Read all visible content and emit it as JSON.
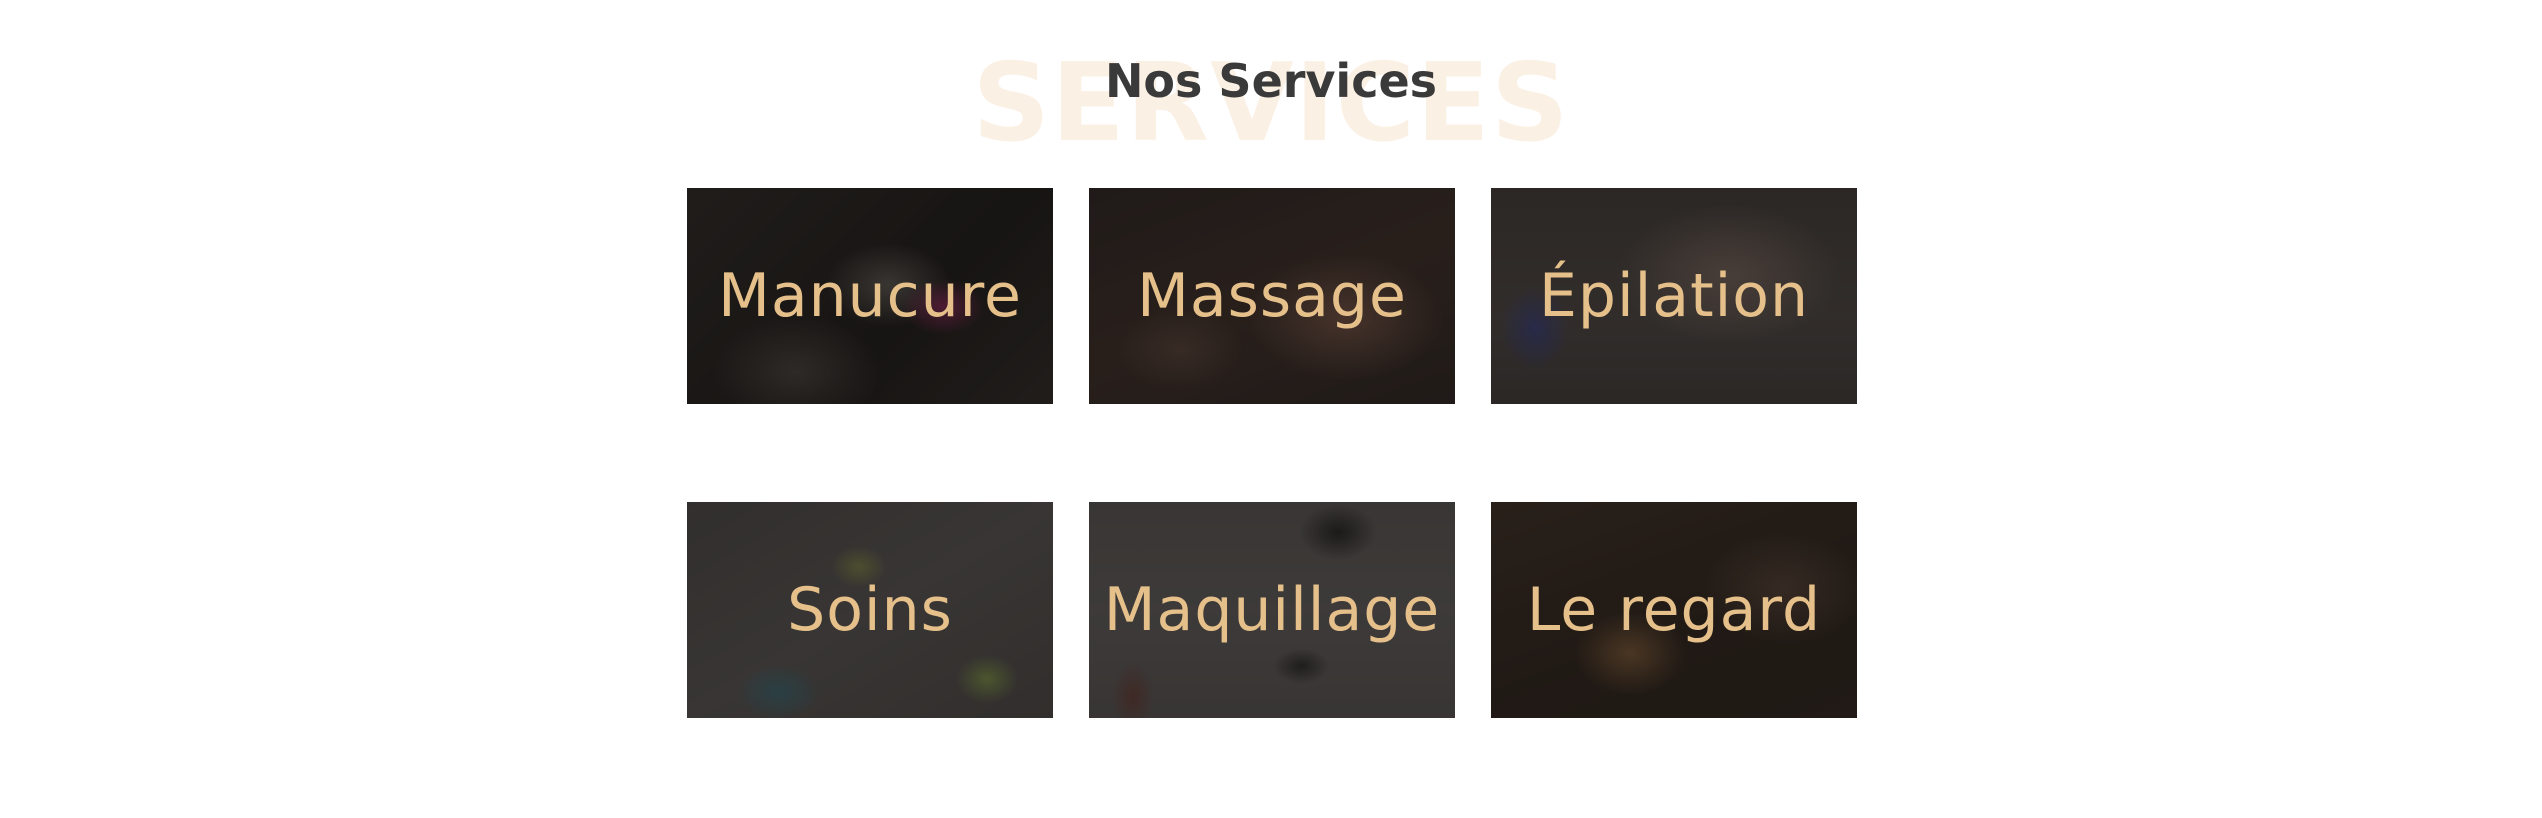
{
  "section": {
    "background_word": "SERVICES",
    "title": "Nos Services"
  },
  "colors": {
    "title_text": "#3a3a3a",
    "background_word": "#fbf0e4",
    "card_label": "#e6c08a",
    "page_background": "#ffffff"
  },
  "services": [
    {
      "label": "Manucure"
    },
    {
      "label": "Massage"
    },
    {
      "label": "Épilation"
    },
    {
      "label": "Soins"
    },
    {
      "label": "Maquillage"
    },
    {
      "label": "Le regard"
    }
  ]
}
